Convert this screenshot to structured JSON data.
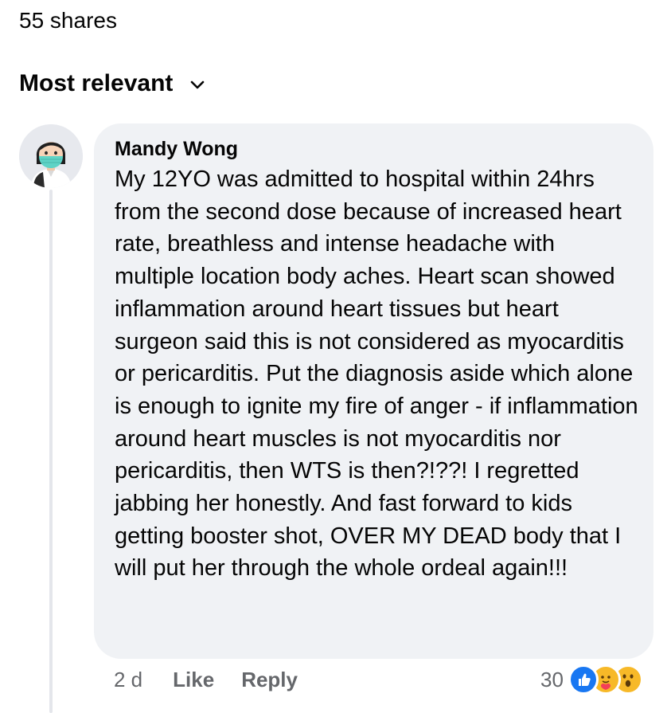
{
  "shares": {
    "text": "55 shares"
  },
  "sort": {
    "label": "Most relevant",
    "icon": "chevron-down-icon"
  },
  "comment": {
    "author": "Mandy Wong",
    "avatar_icon": "masked-person-avatar",
    "text": "My 12YO was admitted to hospital within 24hrs from the second dose because of increased heart rate, breathless and intense headache with multiple location body aches. Heart scan showed inflammation around heart tissues but heart surgeon said this is not considered as myocarditis or pericarditis. Put the diagnosis aside which alone is enough to ignite my fire of anger - if inflammation around heart muscles is not myocarditis nor pericarditis, then WTS is then?!??! I regretted jabbing her honestly. And fast forward to kids getting booster shot, OVER MY DEAD body that I will put her through the whole ordeal again!!!",
    "time": "2 d",
    "like_label": "Like",
    "reply_label": "Reply",
    "reaction_count": "30",
    "reactions": [
      "like-icon",
      "care-icon",
      "wow-icon"
    ]
  },
  "colors": {
    "bubble_bg": "#f0f2f5",
    "secondary_text": "#65676b",
    "like_blue": "#1877f2",
    "reaction_yellow": "#f7b928"
  }
}
